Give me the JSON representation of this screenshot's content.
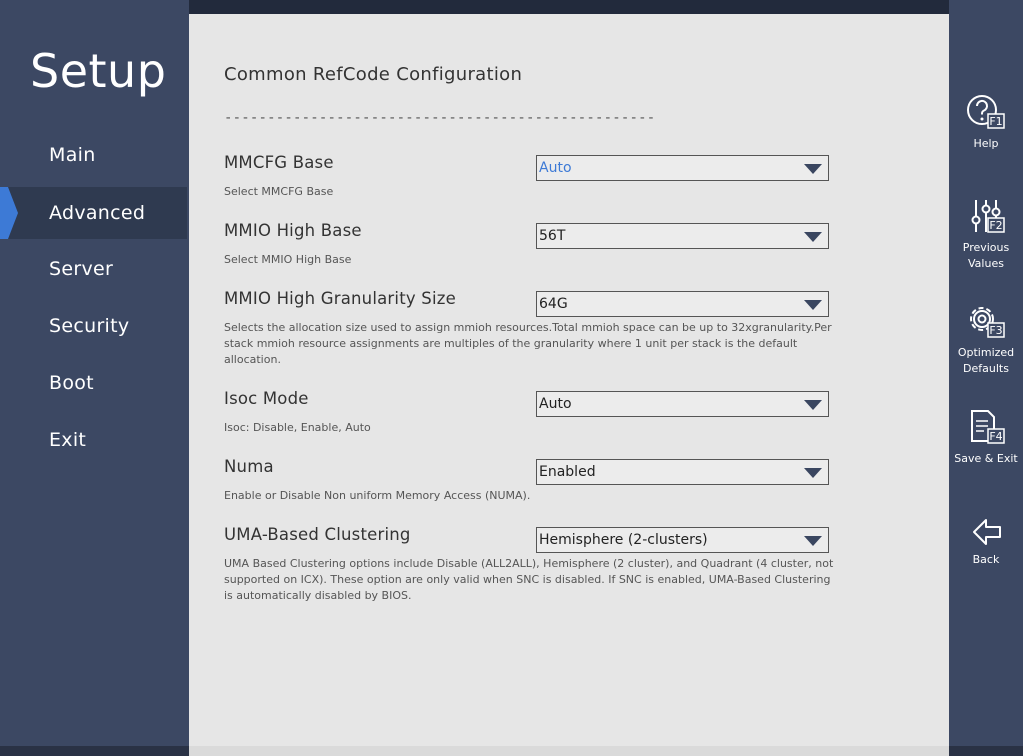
{
  "app": {
    "title": "Setup"
  },
  "nav": {
    "items": [
      {
        "label": "Main"
      },
      {
        "label": "Advanced"
      },
      {
        "label": "Server"
      },
      {
        "label": "Security"
      },
      {
        "label": "Boot"
      },
      {
        "label": "Exit"
      }
    ],
    "active": "Advanced"
  },
  "section": {
    "title": "Common RefCode Configuration",
    "divider": "--------------------------------------------------"
  },
  "settings": [
    {
      "label": "MMCFG Base",
      "value": "Auto",
      "help": "Select MMCFG Base"
    },
    {
      "label": "MMIO High Base",
      "value": "56T",
      "help": "Select MMIO High Base"
    },
    {
      "label": "MMIO High Granularity Size",
      "value": "64G",
      "help": "Selects the allocation size used to assign mmioh resources.Total mmioh space can be up to 32xgranularity.Per stack mmioh resource assignments are multiples of the granularity where 1 unit per stack is the default allocation."
    },
    {
      "label": "Isoc Mode",
      "value": "Auto",
      "help": "Isoc: Disable, Enable, Auto"
    },
    {
      "label": "Numa",
      "value": "Enabled",
      "help": "Enable or Disable Non uniform Memory Access (NUMA)."
    },
    {
      "label": "UMA-Based Clustering",
      "value": "Hemisphere (2-clusters)",
      "help": "UMA Based Clustering options include Disable (ALL2ALL), Hemisphere (2 cluster), and Quadrant (4 cluster, not supported on ICX). These option are only valid when SNC is disabled. If SNC is enabled, UMA-Based Clustering is automatically disabled by BIOS."
    }
  ],
  "fkeys": [
    {
      "key": "F1",
      "label": "Help"
    },
    {
      "key": "F2",
      "label": "Previous Values"
    },
    {
      "key": "F3",
      "label": "Optimized Defaults"
    },
    {
      "key": "F4",
      "label": "Save & Exit"
    },
    {
      "key": "",
      "label": "Back"
    }
  ],
  "colors": {
    "nav_bg": "#3c4863",
    "active_bg": "#2f3a50",
    "active_marker": "#3d7ad6",
    "focused_value": "#3d7ad6",
    "panel_bg": "#e6e6e6"
  },
  "icons": [
    "help-icon",
    "sliders-icon",
    "gear-icon",
    "document-icon",
    "back-arrow-icon"
  ]
}
